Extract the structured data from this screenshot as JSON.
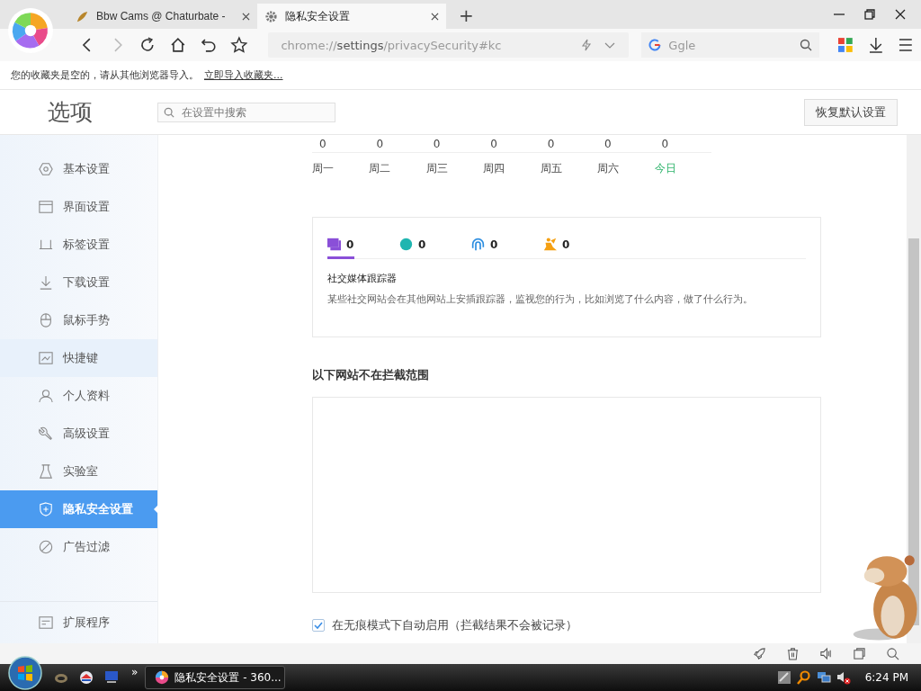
{
  "browser": {
    "tabs": [
      {
        "title": "Bbw Cams @ Chaturbate -",
        "kind": "leaf",
        "selected": false
      },
      {
        "title": "隐私安全设置",
        "kind": "gear",
        "selected": true
      }
    ],
    "new_tab": "+",
    "address": "chrome://**settings**/privacySecurity#kc",
    "search": {
      "placeholder": "Ggle"
    }
  },
  "bookmarks_bar": {
    "message": "您的收藏夹是空的，请从其他浏览器导入。",
    "link": "立即导入收藏夹..."
  },
  "settings": {
    "title": "选项",
    "search": {
      "placeholder": "在设置中搜索"
    },
    "reset_button": "恢复默认设置"
  },
  "sidebar": {
    "items": [
      {
        "label": "基本设置",
        "kind": "gear",
        "selected": false,
        "hovered": false
      },
      {
        "label": "界面设置",
        "kind": "window",
        "selected": false,
        "hovered": false
      },
      {
        "label": "标签设置",
        "kind": "tab",
        "selected": false,
        "hovered": false
      },
      {
        "label": "下载设置",
        "kind": "download",
        "selected": false,
        "hovered": false
      },
      {
        "label": "鼠标手势",
        "kind": "mouse",
        "selected": false,
        "hovered": false
      },
      {
        "label": "快捷键",
        "kind": "keyboard",
        "selected": false,
        "hovered": true
      },
      {
        "label": "个人资料",
        "kind": "person",
        "selected": false,
        "hovered": false
      },
      {
        "label": "高级设置",
        "kind": "wrench",
        "selected": false,
        "hovered": false
      },
      {
        "label": "实验室",
        "kind": "flask",
        "selected": false,
        "hovered": false
      },
      {
        "label": "隐私安全设置",
        "kind": "shield",
        "selected": true,
        "hovered": false
      },
      {
        "label": "广告过滤",
        "kind": "block",
        "selected": false,
        "hovered": false
      }
    ],
    "footer": {
      "label": "扩展程序"
    }
  },
  "week": {
    "counts": [
      "0",
      "0",
      "0",
      "0",
      "0",
      "0",
      "0"
    ],
    "days": [
      {
        "label": "周一",
        "today": false
      },
      {
        "label": "周二",
        "today": false
      },
      {
        "label": "周三",
        "today": false
      },
      {
        "label": "周四",
        "today": false
      },
      {
        "label": "周五",
        "today": false
      },
      {
        "label": "周六",
        "today": false
      },
      {
        "label": "今日",
        "today": true
      }
    ]
  },
  "trackers": {
    "tabs": [
      {
        "kind": "chat",
        "count": "0",
        "color": "#8a4fd8",
        "selected": true
      },
      {
        "kind": "cookie",
        "count": "0",
        "color": "#1fb5b0",
        "selected": false
      },
      {
        "kind": "fingerprint",
        "count": "0",
        "color": "#2b8de0",
        "selected": false
      },
      {
        "kind": "miner",
        "count": "0",
        "color": "#f5a012",
        "selected": false
      }
    ],
    "title": "社交媒体跟踪器",
    "description": "某些社交网站会在其他网站上安插跟踪器，监视您的行为，比如浏览了什么内容，做了什么行为。"
  },
  "whitelist": {
    "title": "以下网站不在拦截范围"
  },
  "incognito": {
    "label": "在无痕模式下自动启用（拦截结果不会被记录）",
    "checked": true
  },
  "taskbar": {
    "more": "»",
    "window": "隐私安全设置 - 360...",
    "time": "6:24 PM"
  }
}
